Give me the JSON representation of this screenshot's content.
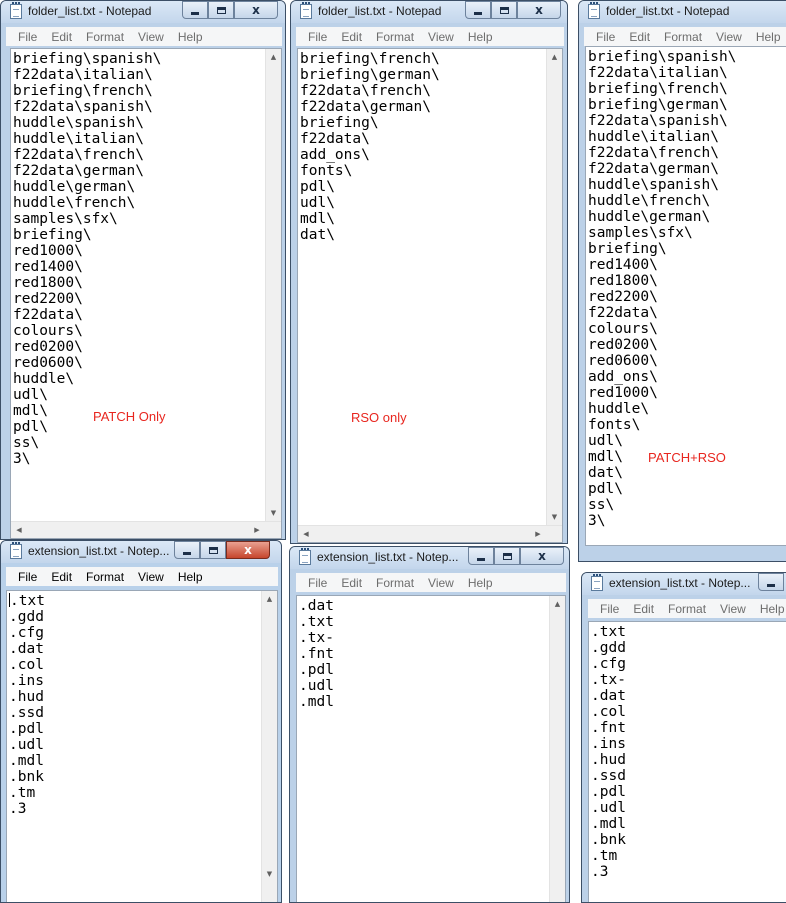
{
  "menu": [
    "File",
    "Edit",
    "Format",
    "View",
    "Help"
  ],
  "scroll_glyphs": {
    "up": "▲",
    "down": "▼",
    "left": "◀",
    "right": "▶"
  },
  "window_buttons": {
    "close": "x"
  },
  "windows": {
    "folder_patch": {
      "title": "folder_list.txt - Notepad",
      "annotation": "PATCH Only",
      "lines": [
        "briefing\\spanish\\",
        "f22data\\italian\\",
        "briefing\\french\\",
        "f22data\\spanish\\",
        "huddle\\spanish\\",
        "huddle\\italian\\",
        "f22data\\french\\",
        "f22data\\german\\",
        "huddle\\german\\",
        "huddle\\french\\",
        "samples\\sfx\\",
        "briefing\\",
        "red1000\\",
        "red1400\\",
        "red1800\\",
        "red2200\\",
        "f22data\\",
        "colours\\",
        "red0200\\",
        "red0600\\",
        "huddle\\",
        "udl\\",
        "mdl\\",
        "pdl\\",
        "ss\\",
        "3\\"
      ]
    },
    "folder_rso": {
      "title": "folder_list.txt - Notepad",
      "annotation": "RSO only",
      "lines": [
        "briefing\\french\\",
        "briefing\\german\\",
        "f22data\\french\\",
        "f22data\\german\\",
        "briefing\\",
        "f22data\\",
        "add_ons\\",
        "fonts\\",
        "pdl\\",
        "udl\\",
        "mdl\\",
        "dat\\"
      ]
    },
    "folder_both": {
      "title": "folder_list.txt - Notepad",
      "annotation": "PATCH+RSO",
      "lines": [
        "briefing\\spanish\\",
        "f22data\\italian\\",
        "briefing\\french\\",
        "briefing\\german\\",
        "f22data\\spanish\\",
        "huddle\\italian\\",
        "f22data\\french\\",
        "f22data\\german\\",
        "huddle\\spanish\\",
        "huddle\\french\\",
        "huddle\\german\\",
        "samples\\sfx\\",
        "briefing\\",
        "red1400\\",
        "red1800\\",
        "red2200\\",
        "f22data\\",
        "colours\\",
        "red0200\\",
        "red0600\\",
        "add_ons\\",
        "red1000\\",
        "huddle\\",
        "fonts\\",
        "udl\\",
        "mdl\\",
        "dat\\",
        "pdl\\",
        "ss\\",
        "3\\"
      ]
    },
    "ext_patch": {
      "title": "extension_list.txt - Notep...",
      "lines": [
        ".txt",
        ".gdd",
        ".cfg",
        ".dat",
        ".col",
        ".ins",
        ".hud",
        ".ssd",
        ".pdl",
        ".udl",
        ".mdl",
        ".bnk",
        ".tm",
        ".3"
      ]
    },
    "ext_rso": {
      "title": "extension_list.txt - Notep...",
      "lines": [
        ".dat",
        ".txt",
        ".tx-",
        ".fnt",
        ".pdl",
        ".udl",
        ".mdl"
      ]
    },
    "ext_both": {
      "title": "extension_list.txt - Notep...",
      "lines": [
        ".txt",
        ".gdd",
        ".cfg",
        ".tx-",
        ".dat",
        ".col",
        ".fnt",
        ".ins",
        ".hud",
        ".ssd",
        ".pdl",
        ".udl",
        ".mdl",
        ".bnk",
        ".tm",
        ".3"
      ]
    }
  }
}
